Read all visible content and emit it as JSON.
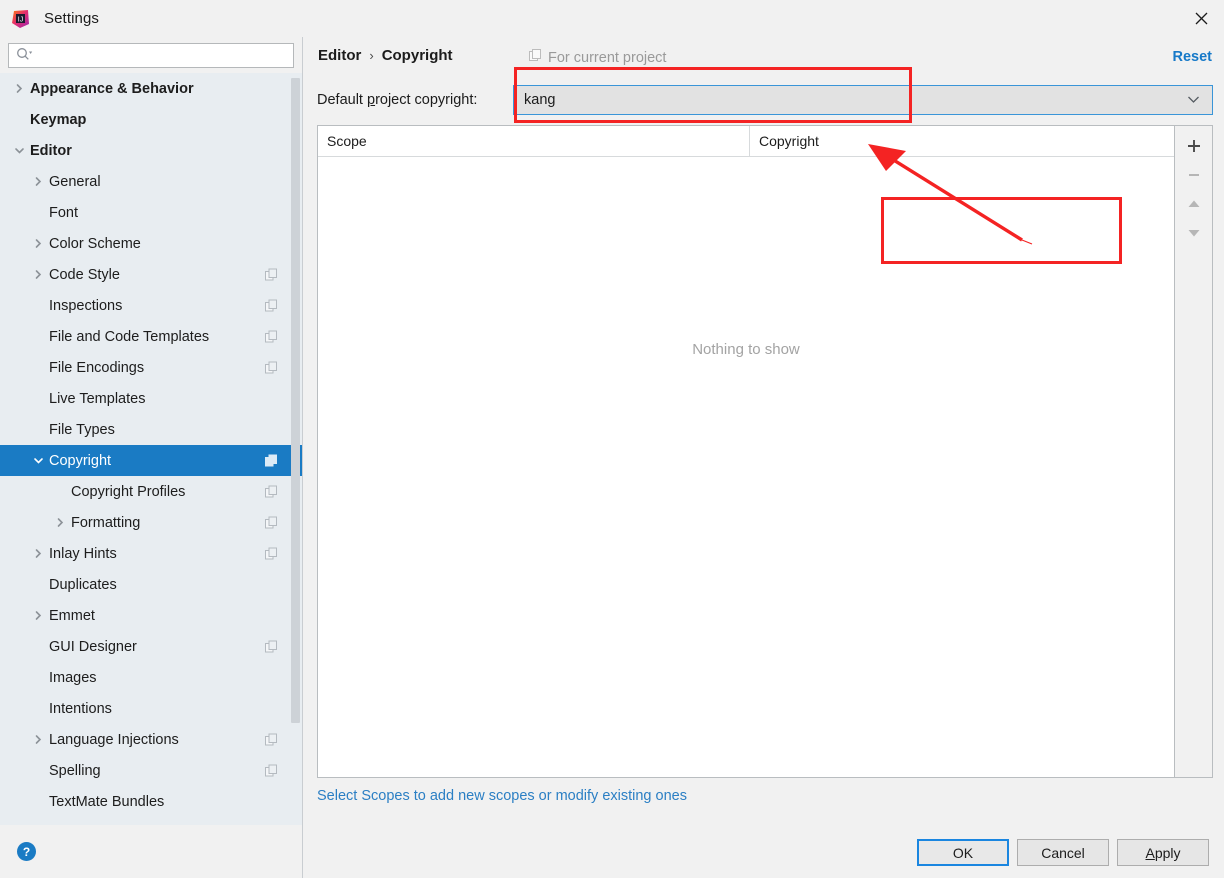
{
  "window": {
    "title": "Settings",
    "app_icon": "intellij-idea-icon",
    "close_icon": "close-icon"
  },
  "search": {
    "value": "",
    "placeholder": "",
    "icon": "search-icon"
  },
  "sidebar": {
    "items": [
      {
        "label": "Appearance & Behavior",
        "depth": 0,
        "bold": true,
        "chevron": "right",
        "copy_icon": false,
        "selected": false
      },
      {
        "label": "Keymap",
        "depth": 0,
        "bold": true,
        "chevron": "none",
        "copy_icon": false,
        "selected": false
      },
      {
        "label": "Editor",
        "depth": 0,
        "bold": true,
        "chevron": "down",
        "copy_icon": false,
        "selected": false
      },
      {
        "label": "General",
        "depth": 1,
        "bold": false,
        "chevron": "right",
        "copy_icon": false,
        "selected": false
      },
      {
        "label": "Font",
        "depth": 1,
        "bold": false,
        "chevron": "none",
        "copy_icon": false,
        "selected": false
      },
      {
        "label": "Color Scheme",
        "depth": 1,
        "bold": false,
        "chevron": "right",
        "copy_icon": false,
        "selected": false
      },
      {
        "label": "Code Style",
        "depth": 1,
        "bold": false,
        "chevron": "right",
        "copy_icon": true,
        "selected": false
      },
      {
        "label": "Inspections",
        "depth": 1,
        "bold": false,
        "chevron": "none",
        "copy_icon": true,
        "selected": false
      },
      {
        "label": "File and Code Templates",
        "depth": 1,
        "bold": false,
        "chevron": "none",
        "copy_icon": true,
        "selected": false
      },
      {
        "label": "File Encodings",
        "depth": 1,
        "bold": false,
        "chevron": "none",
        "copy_icon": true,
        "selected": false
      },
      {
        "label": "Live Templates",
        "depth": 1,
        "bold": false,
        "chevron": "none",
        "copy_icon": false,
        "selected": false
      },
      {
        "label": "File Types",
        "depth": 1,
        "bold": false,
        "chevron": "none",
        "copy_icon": false,
        "selected": false
      },
      {
        "label": "Copyright",
        "depth": 1,
        "bold": false,
        "chevron": "down",
        "copy_icon": true,
        "selected": true
      },
      {
        "label": "Copyright Profiles",
        "depth": 2,
        "bold": false,
        "chevron": "none",
        "copy_icon": true,
        "selected": false
      },
      {
        "label": "Formatting",
        "depth": 2,
        "bold": false,
        "chevron": "right",
        "copy_icon": true,
        "selected": false
      },
      {
        "label": "Inlay Hints",
        "depth": 1,
        "bold": false,
        "chevron": "right",
        "copy_icon": true,
        "selected": false
      },
      {
        "label": "Duplicates",
        "depth": 1,
        "bold": false,
        "chevron": "none",
        "copy_icon": false,
        "selected": false
      },
      {
        "label": "Emmet",
        "depth": 1,
        "bold": false,
        "chevron": "right",
        "copy_icon": false,
        "selected": false
      },
      {
        "label": "GUI Designer",
        "depth": 1,
        "bold": false,
        "chevron": "none",
        "copy_icon": true,
        "selected": false
      },
      {
        "label": "Images",
        "depth": 1,
        "bold": false,
        "chevron": "none",
        "copy_icon": false,
        "selected": false
      },
      {
        "label": "Intentions",
        "depth": 1,
        "bold": false,
        "chevron": "none",
        "copy_icon": false,
        "selected": false
      },
      {
        "label": "Language Injections",
        "depth": 1,
        "bold": false,
        "chevron": "right",
        "copy_icon": true,
        "selected": false
      },
      {
        "label": "Spelling",
        "depth": 1,
        "bold": false,
        "chevron": "none",
        "copy_icon": true,
        "selected": false
      },
      {
        "label": "TextMate Bundles",
        "depth": 1,
        "bold": false,
        "chevron": "none",
        "copy_icon": false,
        "selected": false
      }
    ],
    "help_icon": "help-question-icon"
  },
  "main": {
    "breadcrumb": {
      "parent": "Editor",
      "separator": "›",
      "current": "Copyright"
    },
    "for_current_project": {
      "label": "For current project",
      "icon": "copy-scope-icon"
    },
    "reset_label": "Reset",
    "default_copyright": {
      "label_prefix": "Default ",
      "label_underlined": "p",
      "label_suffix": "roject copyright:",
      "value": "kang",
      "dropdown_icon": "chevron-down-icon"
    },
    "table": {
      "columns": [
        "Scope",
        "Copyright"
      ],
      "rows": [],
      "empty_text": "Nothing to show",
      "tools": [
        {
          "name": "add-row-button",
          "icon": "plus-icon",
          "label": "+"
        },
        {
          "name": "remove-row-button",
          "icon": "minus-icon",
          "label": "−"
        },
        {
          "name": "move-up-button",
          "icon": "arrow-up-icon",
          "label": "▲"
        },
        {
          "name": "move-down-button",
          "icon": "arrow-down-icon",
          "label": "▼"
        }
      ]
    },
    "bottom_link": "Select Scopes to add new scopes or modify existing ones"
  },
  "footer": {
    "ok": "OK",
    "cancel": "Cancel",
    "apply_underlined": "A",
    "apply_rest": "pply"
  },
  "annotations": {
    "accent_color": "#f42323",
    "combo_highlight": "red rectangle around Default project copyright combobox",
    "pointer_rect": "red rectangle in table body",
    "arrow": "red arrow pointing to Copyright column header"
  },
  "colors": {
    "selection": "#1a7bc4",
    "link": "#2b7fc4",
    "reset_link": "#1679c8",
    "sidebar_bg": "#e8edf1",
    "panel_bg": "#f1f1f1",
    "annotation_red": "#f42323"
  }
}
